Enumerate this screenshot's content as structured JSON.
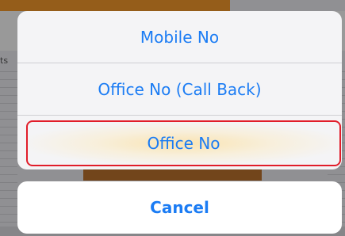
{
  "background": {
    "side_text": "ts"
  },
  "action_sheet": {
    "options": [
      {
        "label": "Mobile No"
      },
      {
        "label": "Office No (Call Back)"
      },
      {
        "label": "Office No"
      }
    ],
    "cancel_label": "Cancel",
    "highlighted_option": "Office No"
  },
  "colors": {
    "accent": "#1b7cf4",
    "highlight_border": "#e11d2a",
    "brand_orange": "#f0962a"
  }
}
